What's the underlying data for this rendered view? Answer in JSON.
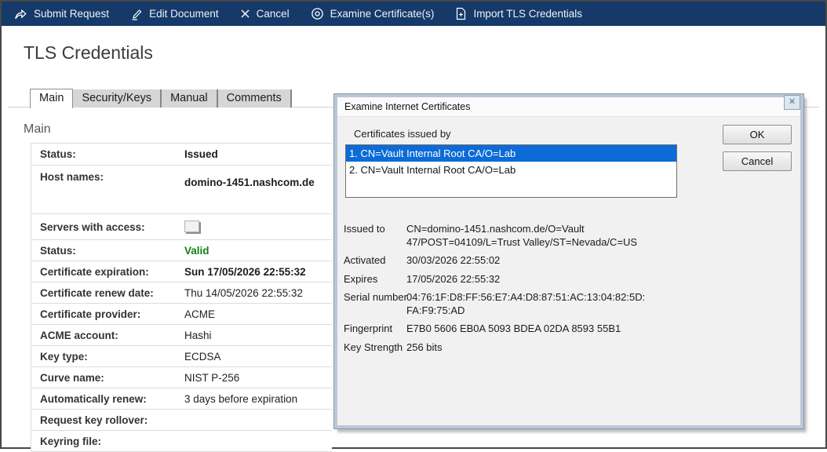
{
  "toolbar": {
    "items": [
      {
        "label": "Submit Request",
        "icon": "submit-arrow-icon"
      },
      {
        "label": "Edit Document",
        "icon": "edit-pencil-icon"
      },
      {
        "label": "Cancel",
        "icon": "cancel-x-icon"
      },
      {
        "label": "Examine Certificate(s)",
        "icon": "examine-certificates-icon"
      },
      {
        "label": "Import TLS Credentials",
        "icon": "import-document-icon"
      }
    ]
  },
  "page": {
    "title": "TLS Credentials"
  },
  "tabs": [
    {
      "label": "Main",
      "active": true
    },
    {
      "label": "Security/Keys",
      "active": false
    },
    {
      "label": "Manual",
      "active": false
    },
    {
      "label": "Comments",
      "active": false
    }
  ],
  "form": {
    "section_title": "Main",
    "rows": [
      {
        "label": "Status:",
        "value": "Issued",
        "emphasis": "bold"
      },
      {
        "label": "Host names:",
        "value": "domino-1451.nashcom.de",
        "emphasis": "bold"
      },
      {
        "label": "Servers with access:",
        "value": "",
        "widget": "button"
      },
      {
        "label": "Status:",
        "value": "Valid",
        "emphasis": "bold-green"
      },
      {
        "label": "Certificate expiration:",
        "value": "Sun 17/05/2026 22:55:32",
        "emphasis": "bold"
      },
      {
        "label": "Certificate renew date:",
        "value": "Thu 14/05/2026 22:55:32"
      },
      {
        "label": "Certificate provider:",
        "value": "ACME"
      },
      {
        "label": "ACME account:",
        "value": "Hashi"
      },
      {
        "label": "Key type:",
        "value": "ECDSA"
      },
      {
        "label": "Curve name:",
        "value": "NIST P-256"
      },
      {
        "label": "Automatically renew:",
        "value": "3 days before expiration"
      },
      {
        "label": "Request key rollover:",
        "value": ""
      },
      {
        "label": "Keyring file:",
        "value": ""
      }
    ]
  },
  "dialog": {
    "title": "Examine Internet Certificates",
    "close_glyph": "✕",
    "list_label": "Certificates issued by",
    "list_items": [
      {
        "text": "1. CN=Vault Internal Root CA/O=Lab",
        "selected": true
      },
      {
        "text": "2. CN=Vault Internal Root CA/O=Lab",
        "selected": false
      }
    ],
    "buttons": {
      "ok": "OK",
      "cancel": "Cancel"
    },
    "details": [
      {
        "label": "Issued to",
        "value": "CN=domino-1451.nashcom.de/O=Vault\n47/POST=04109/L=Trust Valley/ST=Nevada/C=US"
      },
      {
        "label": "Activated",
        "value": "30/03/2026 22:55:02"
      },
      {
        "label": "Expires",
        "value": "17/05/2026 22:55:32"
      },
      {
        "label": "Serial number",
        "value": "04:76:1F:D8:FF:56:E7:A4:D8:87:51:AC:13:04:82:5D:\nFA:F9:75:AD"
      },
      {
        "label": "Fingerprint",
        "value": "E7B0 5606 EB0A 5093 BDEA 02DA 8593 55B1"
      },
      {
        "label": "Key Strength",
        "value": "256 bits"
      }
    ]
  },
  "colors": {
    "toolbar_bg": "#153a69",
    "valid_green": "#128012",
    "list_selection_blue": "#0d6bd7",
    "dialog_frame": "#b9c7d7",
    "dialog_body": "#f1f1f1"
  }
}
